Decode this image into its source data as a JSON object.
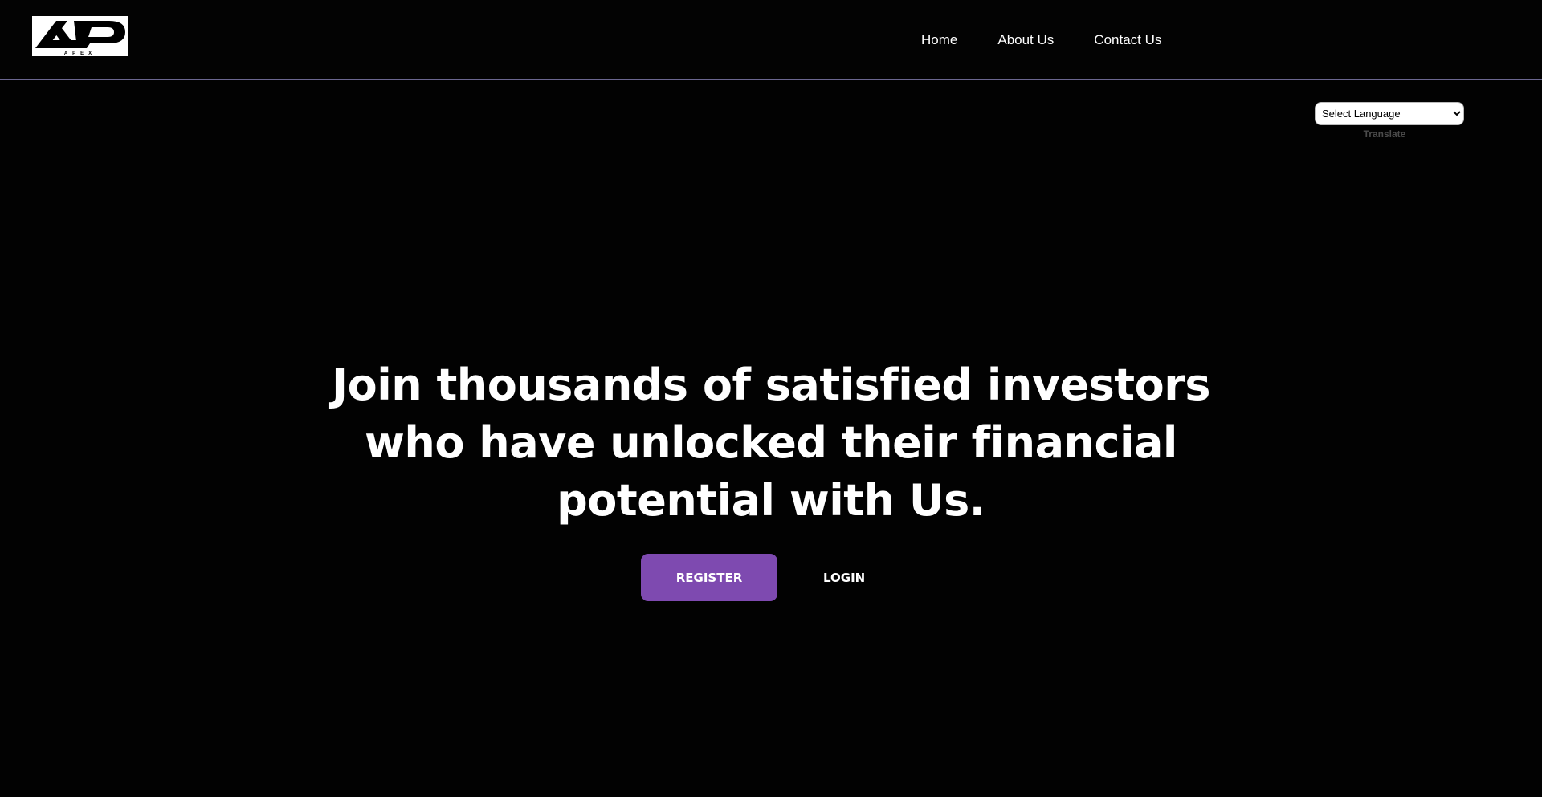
{
  "header": {
    "logo": {
      "text": "APEX",
      "icon": "apex-logo"
    },
    "nav": [
      {
        "label": "Home"
      },
      {
        "label": "About Us"
      },
      {
        "label": "Contact Us"
      }
    ]
  },
  "translate": {
    "selected": "Select Language",
    "link": "Translate"
  },
  "hero": {
    "title": "Join thousands of satisfied investors who have unlocked their financial potential with Us.",
    "register_label": "REGISTER",
    "login_label": "LOGIN"
  },
  "colors": {
    "background": "#020202",
    "accent": "#7e4ab0",
    "divider": "#6b6790"
  }
}
